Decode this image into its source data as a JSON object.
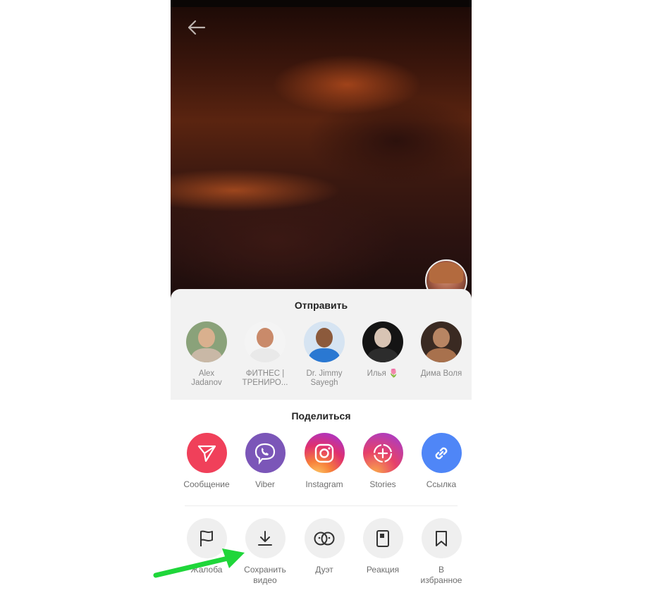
{
  "send": {
    "title": "Отправить",
    "contacts": [
      {
        "name": "Alex\nJadanov"
      },
      {
        "name": "ФИТНЕС |\nТРЕНИРО..."
      },
      {
        "name": "Dr. Jimmy\nSayegh"
      },
      {
        "name": "Илья 🌷"
      },
      {
        "name": "Дима Воля"
      }
    ]
  },
  "share": {
    "title": "Поделиться",
    "items": [
      {
        "label": "Сообщение",
        "icon": "send-plane-icon",
        "color": "#f0405a"
      },
      {
        "label": "Viber",
        "icon": "viber-icon",
        "color": "#7b56b8"
      },
      {
        "label": "Instagram",
        "icon": "instagram-icon",
        "color": "#d6307a"
      },
      {
        "label": "Stories",
        "icon": "stories-add-icon",
        "color": "#d13a8a"
      },
      {
        "label": "Ссылка",
        "icon": "link-icon",
        "color": "#4f86f7"
      }
    ]
  },
  "actions": {
    "items": [
      {
        "label": "Жалоба",
        "icon": "flag-icon"
      },
      {
        "label": "Сохранить\nвидео",
        "icon": "download-icon"
      },
      {
        "label": "Дуэт",
        "icon": "duet-icon"
      },
      {
        "label": "Реакция",
        "icon": "reaction-icon"
      },
      {
        "label": "В\nизбранное",
        "icon": "bookmark-icon"
      }
    ]
  },
  "annotation": {
    "arrow_color": "#1fd63a"
  }
}
